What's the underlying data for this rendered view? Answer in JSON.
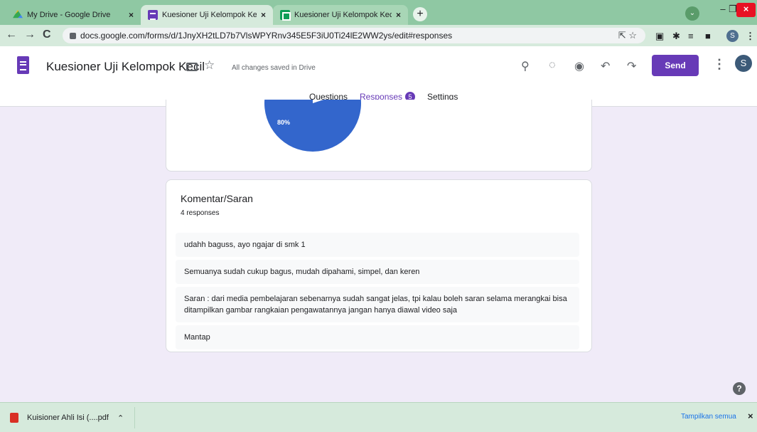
{
  "browser": {
    "tabs": [
      {
        "title": "My Drive - Google Drive",
        "favicon": "google-drive-icon"
      },
      {
        "title": "Kuesioner Uji Kelompok Kecil - G",
        "favicon": "google-forms-icon"
      },
      {
        "title": "Kuesioner Uji Kelompok Kecil (Re",
        "favicon": "google-sheets-icon"
      }
    ],
    "tab_close": "×",
    "new_tab": "+",
    "profile_initial": "S",
    "url": "docs.google.com/forms/d/1JnyXH2tLD7b7VlsWPYRnv345E5F3iU0Ti24lE2WW2ys/edit#responses",
    "window": {
      "minimize": "–",
      "maximize": "❐",
      "close": "×"
    }
  },
  "form": {
    "title": "Kuesioner Uji Kelompok Kecil",
    "save_status": "All changes saved in Drive",
    "send_label": "Send",
    "avatar_initial": "S",
    "tabs": {
      "questions": "Questions",
      "responses": "Responses",
      "responses_count": "5",
      "settings": "Settings"
    }
  },
  "chart_data": {
    "type": "pie",
    "slices": [
      {
        "label": "80%",
        "value": 80,
        "color": "#3366cc"
      }
    ]
  },
  "question": {
    "title": "Komentar/Saran",
    "count": "4 responses",
    "answers": [
      "udahh baguss, ayo ngajar di smk 1",
      "Semuanya sudah cukup bagus, mudah dipahami, simpel, dan keren",
      "Saran : dari media pembelajaran sebenarnya sudah sangat jelas, tpi kalau boleh saran selama merangkai bisa ditampilkan gambar rangkaian pengawatannya jangan hanya diawal video saja",
      "Mantap"
    ]
  },
  "help_label": "?",
  "download_bar": {
    "filename": "Kuisioner Ahli Isi (....pdf",
    "show_all": "Tampilkan semua",
    "close": "×"
  }
}
